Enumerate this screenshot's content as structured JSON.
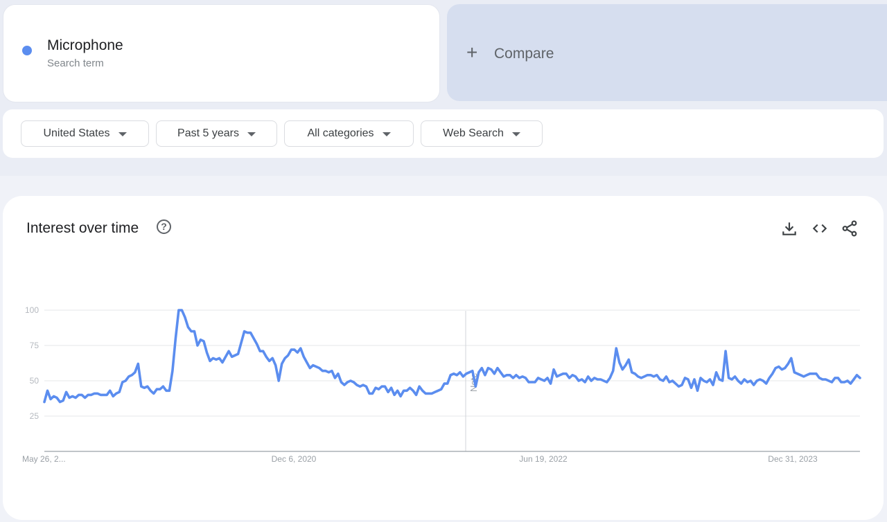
{
  "search_term": {
    "name": "Microphone",
    "subtitle": "Search term",
    "color": "#5b8def"
  },
  "compare": {
    "label": "Compare",
    "icon": "plus-icon"
  },
  "filters": [
    {
      "label": "United States"
    },
    {
      "label": "Past 5 years"
    },
    {
      "label": "All categories"
    },
    {
      "label": "Web Search"
    }
  ],
  "panel": {
    "title": "Interest over time",
    "help_icon": "?",
    "actions": [
      "download-icon",
      "embed-code-icon",
      "share-icon"
    ]
  },
  "chart_data": {
    "type": "line",
    "title": "Interest over time",
    "xlabel": "",
    "ylabel": "",
    "ylim": [
      0,
      100
    ],
    "yticks": [
      25,
      50,
      75,
      100
    ],
    "x_tick_labels": [
      "May 26, 2...",
      "Dec 6, 2020",
      "Jun 19, 2022",
      "Dec 31, 2023"
    ],
    "x_range": [
      "May 26, 2019",
      "May 2024"
    ],
    "grid": true,
    "legend": "none",
    "annotations": [
      {
        "label": "Note",
        "position": "vertical marker ~Jan 2022"
      }
    ],
    "series": [
      {
        "name": "Microphone",
        "color": "#5b8def",
        "frequency": "weekly",
        "values": [
          35,
          43,
          37,
          39,
          38,
          35,
          36,
          42,
          38,
          39,
          38,
          40,
          40,
          38,
          40,
          40,
          41,
          41,
          40,
          40,
          40,
          43,
          39,
          41,
          42,
          49,
          50,
          53,
          54,
          56,
          62,
          46,
          45,
          46,
          43,
          41,
          44,
          44,
          46,
          43,
          43,
          57,
          80,
          100,
          100,
          95,
          88,
          85,
          85,
          75,
          79,
          78,
          70,
          64,
          66,
          65,
          66,
          63,
          67,
          71,
          67,
          68,
          69,
          77,
          85,
          84,
          84,
          80,
          76,
          71,
          71,
          67,
          64,
          66,
          61,
          50,
          62,
          66,
          68,
          72,
          72,
          70,
          73,
          67,
          63,
          59,
          61,
          60,
          59,
          57,
          57,
          56,
          57,
          52,
          55,
          49,
          47,
          49,
          50,
          49,
          47,
          46,
          47,
          46,
          41,
          41,
          45,
          44,
          46,
          46,
          42,
          45,
          40,
          43,
          39,
          43,
          43,
          45,
          43,
          40,
          46,
          43,
          41,
          41,
          41,
          42,
          43,
          44,
          48,
          48,
          54,
          55,
          54,
          56,
          53,
          55,
          56,
          57,
          46,
          56,
          59,
          54,
          59,
          58,
          55,
          59,
          56,
          53,
          54,
          54,
          52,
          54,
          52,
          53,
          52,
          49,
          49,
          49,
          52,
          51,
          50,
          52,
          48,
          58,
          53,
          54,
          55,
          55,
          52,
          54,
          53,
          50,
          51,
          49,
          53,
          50,
          52,
          51,
          51,
          50,
          49,
          52,
          57,
          73,
          63,
          58,
          61,
          65,
          56,
          55,
          53,
          52,
          53,
          54,
          54,
          53,
          54,
          51,
          50,
          53,
          49,
          50,
          48,
          46,
          47,
          52,
          51,
          45,
          51,
          43,
          52,
          50,
          49,
          51,
          47,
          56,
          51,
          50,
          71,
          52,
          51,
          53,
          50,
          48,
          51,
          49,
          50,
          47,
          50,
          51,
          50,
          48,
          52,
          55,
          59,
          60,
          58,
          59,
          62,
          66,
          56,
          55,
          54,
          53,
          54,
          55,
          55,
          55,
          52,
          51,
          51,
          50,
          49,
          52,
          52,
          49,
          49,
          50,
          48,
          51,
          54,
          52
        ]
      }
    ]
  }
}
